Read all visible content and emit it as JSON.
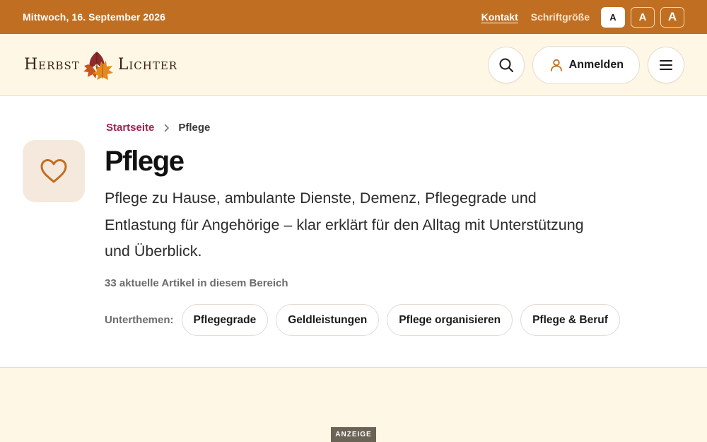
{
  "topbar": {
    "date": "Mittwoch, 16. September 2026",
    "contact_label": "Kontakt",
    "font_size_label": "Schriftgröße",
    "font_size_options": [
      "A",
      "A",
      "A"
    ],
    "background_color": "#c06f22"
  },
  "header": {
    "logo": {
      "word_left": "Herbst",
      "word_right": "Lichter",
      "icon": "autumn-leaves-icon"
    },
    "search_icon": "search-icon",
    "login_label": "Anmelden",
    "user_icon": "user-icon",
    "menu_icon": "menu-icon",
    "background_color": "#fef7e6"
  },
  "breadcrumb": {
    "home": "Startseite",
    "separator_icon": "chevron-right-icon",
    "current": "Pflege"
  },
  "category": {
    "icon": "heart-icon",
    "title": "Pflege",
    "lead": "Pflege zu Hause, ambulante Dienste, Demenz, Pflegegrade und Entlastung für Angehörige – klar erklärt für den Alltag mit Unterstützung und Überblick.",
    "article_count_text": "33 aktuelle Artikel in diesem Bereich",
    "accent_color": "#a3224f"
  },
  "subtopics": {
    "label": "Unterthemen:",
    "items": [
      "Pflegegrade",
      "Geldleistungen",
      "Pflege organisieren",
      "Pflege & Beruf"
    ]
  },
  "ad": {
    "label": "ANZEIGE"
  }
}
